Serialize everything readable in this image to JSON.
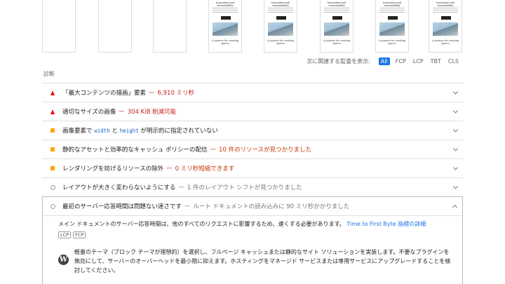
{
  "filmstrip": {
    "thumb_title": "Innovation and sustainability",
    "thumb_caption": "A passion for creating spaces",
    "frames": [
      {
        "type": "blank"
      },
      {
        "type": "blank"
      },
      {
        "type": "blank"
      },
      {
        "type": "page"
      },
      {
        "type": "page"
      },
      {
        "type": "page"
      },
      {
        "type": "page"
      },
      {
        "type": "page"
      }
    ]
  },
  "filters": {
    "label": "次に関連する監査を表示:",
    "chips": [
      {
        "label": "All",
        "active": true
      },
      {
        "label": "FCP",
        "active": false
      },
      {
        "label": "LCP",
        "active": false
      },
      {
        "label": "TBT",
        "active": false
      },
      {
        "label": "CLS",
        "active": false
      }
    ]
  },
  "section": {
    "title": "診断"
  },
  "audits": [
    {
      "status": "fail",
      "title": "「最大コンテンツの描画」要素",
      "display": "6,910 ミリ秒"
    },
    {
      "status": "fail",
      "title": "適切なサイズの画像",
      "display": "304 KiB 削減可能"
    },
    {
      "status": "average",
      "title_pre": "画像要素で ",
      "code1": "width",
      "title_mid": " と ",
      "code2": "height",
      "title_post": " が明示的に指定されていない"
    },
    {
      "status": "average",
      "title": "静的なアセットと効率的なキャッシュ ポリシーの配信",
      "display": "10 件のリソースが見つかりました"
    },
    {
      "status": "average",
      "title": "レンダリングを妨げるリソースの除外",
      "display": "0 ミリ秒短縮できます"
    },
    {
      "status": "info",
      "title": "レイアウトが大きく変わらないようにする",
      "display": "1 件のレイアウト シフトが見つかりました"
    }
  ],
  "expanded": {
    "title": "最初のサーバー応答時間は問題ない速さです",
    "display": "ルート ドキュメントの読み込みに 90 ミリ秒かかりました",
    "description": "メイン ドキュメントのサーバー応答時間は、他のすべてのリクエストに影響するため、速くする必要があります。",
    "link": "Time to First Byte 指標の詳細",
    "tags": [
      "LCP",
      "FCP"
    ],
    "stack_icon": "wordpress-icon",
    "stack_glyph": "W",
    "stack_text": "軽量のテーマ（ブロック テーマが理想的）を選択し、フルページ キャッシュまたは静的なサイト ソリューションを実装します。不要なプラグインを無効にして、サーバーのオーバーヘッドを最小限に抑えます。ホスティングをマネージド サービスまたは専用サービスにアップグレードすることを検討してください。"
  },
  "colors": {
    "fail": "#eb0f00",
    "average": "#ffa400",
    "accent": "#1a73e8"
  }
}
